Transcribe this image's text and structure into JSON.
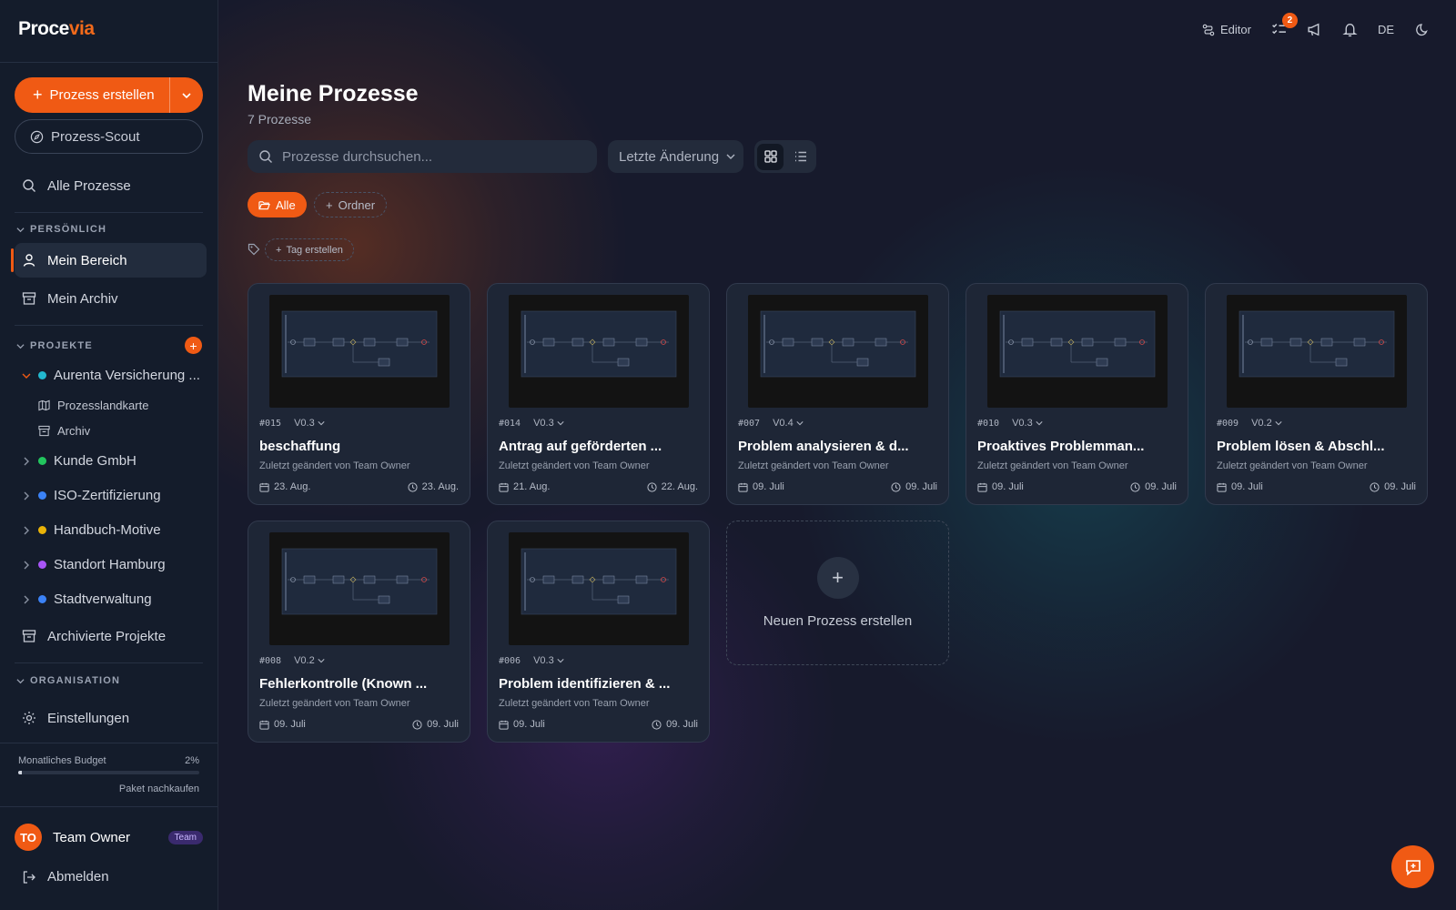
{
  "app": {
    "logo_main": "Proce",
    "logo_accent": "via"
  },
  "sidebar": {
    "create_button": "Prozess erstellen",
    "scout_button": "Prozess-Scout",
    "all_processes": "Alle Prozesse",
    "section_personal": "PERSÖNLICH",
    "my_area": "Mein Bereich",
    "my_archive": "Mein Archiv",
    "section_projects": "PROJEKTE",
    "add_project": "+",
    "projects": [
      {
        "name": "Aurenta Versicherung ...",
        "color": "#22b8cf",
        "expanded": true
      },
      {
        "name": "Kunde GmbH",
        "color": "#22c55e",
        "expanded": false
      },
      {
        "name": "ISO-Zertifizierung",
        "color": "#3b82f6",
        "expanded": false
      },
      {
        "name": "Handbuch-Motive",
        "color": "#eab308",
        "expanded": false
      },
      {
        "name": "Standort Hamburg",
        "color": "#a855f7",
        "expanded": false
      },
      {
        "name": "Stadtverwaltung",
        "color": "#3b82f6",
        "expanded": false
      }
    ],
    "sub_items": [
      "Prozesslandkarte",
      "Archiv"
    ],
    "archived_projects": "Archivierte Projekte",
    "section_org": "ORGANISATION",
    "settings": "Einstellungen",
    "budget_label": "Monatliches Budget",
    "budget_pct": "2%",
    "budget_fraction": 0.02,
    "budget_link": "Paket nachkaufen",
    "user_initials": "TO",
    "user_name": "Team Owner",
    "user_badge": "Team",
    "logout": "Abmelden"
  },
  "topbar": {
    "editor": "Editor",
    "tasks_badge": "2",
    "language": "DE"
  },
  "main": {
    "title": "Meine Prozesse",
    "subtitle": "7 Prozesse",
    "search_placeholder": "Prozesse durchsuchen...",
    "sort_label": "Letzte Änderung",
    "chip_all": "Alle",
    "chip_folder": "Ordner",
    "chip_tag": "Tag erstellen",
    "new_process": "Neuen Prozess erstellen"
  },
  "cards": [
    {
      "num": "#015",
      "ver": "V0.3",
      "title": "beschaffung",
      "changed": "Zuletzt geändert von Team Owner",
      "created": "23. Aug.",
      "updated": "23. Aug."
    },
    {
      "num": "#014",
      "ver": "V0.3",
      "title": "Antrag auf geförderten ...",
      "changed": "Zuletzt geändert von Team Owner",
      "created": "21. Aug.",
      "updated": "22. Aug."
    },
    {
      "num": "#007",
      "ver": "V0.4",
      "title": "Problem analysieren & d...",
      "changed": "Zuletzt geändert von Team Owner",
      "created": "09. Juli",
      "updated": "09. Juli"
    },
    {
      "num": "#010",
      "ver": "V0.3",
      "title": "Proaktives Problemman...",
      "changed": "Zuletzt geändert von Team Owner",
      "created": "09. Juli",
      "updated": "09. Juli"
    },
    {
      "num": "#009",
      "ver": "V0.2",
      "title": "Problem lösen & Abschl...",
      "changed": "Zuletzt geändert von Team Owner",
      "created": "09. Juli",
      "updated": "09. Juli"
    },
    {
      "num": "#008",
      "ver": "V0.2",
      "title": "Fehlerkontrolle (Known ...",
      "changed": "Zuletzt geändert von Team Owner",
      "created": "09. Juli",
      "updated": "09. Juli"
    },
    {
      "num": "#006",
      "ver": "V0.3",
      "title": "Problem identifizieren & ...",
      "changed": "Zuletzt geändert von Team Owner",
      "created": "09. Juli",
      "updated": "09. Juli"
    }
  ],
  "colors": {
    "accent": "#f05a14",
    "sidebar_bg": "#141c2b",
    "card_bg": "#1e2636"
  }
}
